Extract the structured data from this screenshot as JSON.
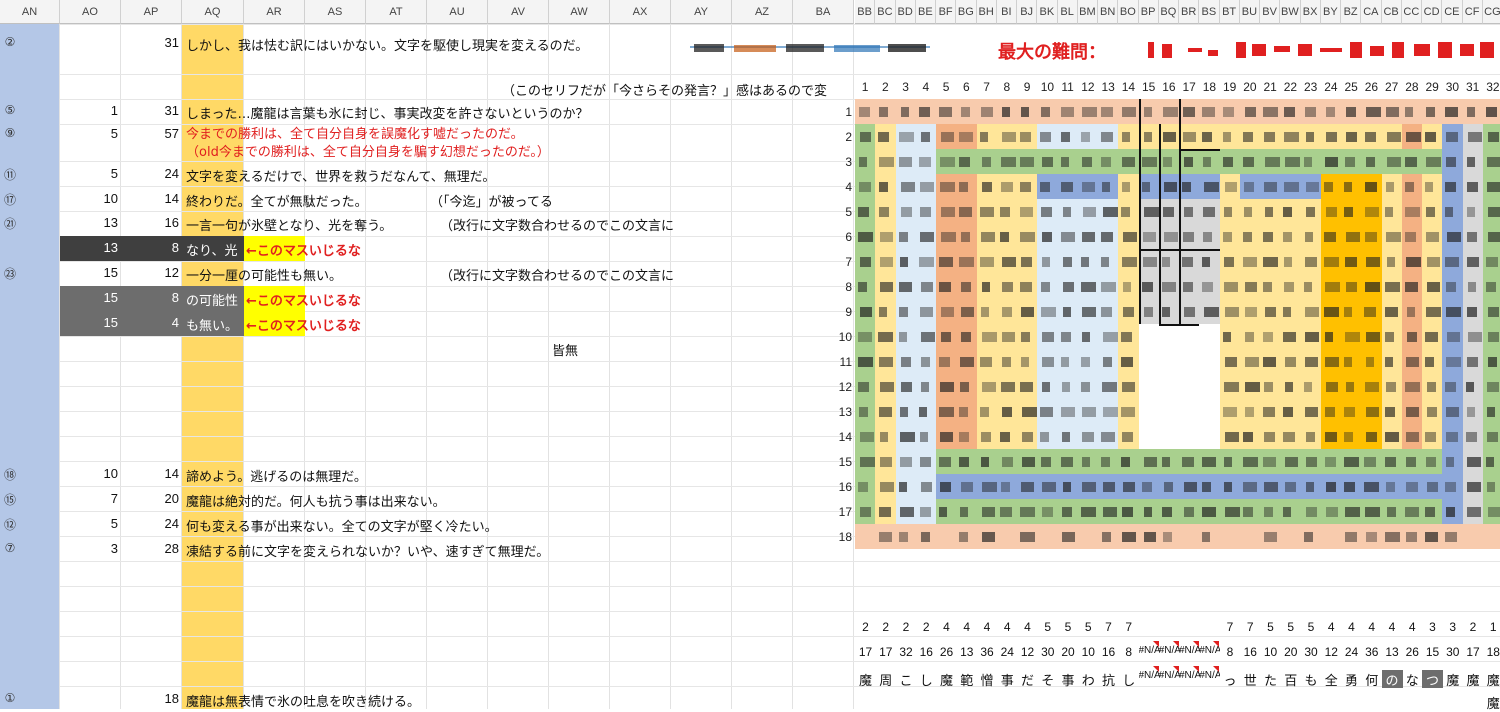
{
  "columns_left": [
    "AN",
    "AO",
    "AP",
    "AQ",
    "AR",
    "AS",
    "AT",
    "AU",
    "AV",
    "AW",
    "AX",
    "AY",
    "AZ",
    "BA"
  ],
  "columns_right": [
    "BB",
    "BC",
    "BD",
    "BE",
    "BF",
    "BG",
    "BH",
    "BI",
    "BJ",
    "BK",
    "BL",
    "BM",
    "BN",
    "BO",
    "BP",
    "BQ",
    "BR",
    "BS",
    "BT",
    "BU",
    "BV",
    "BW",
    "BX",
    "BY",
    "BZ",
    "CA",
    "CB",
    "CC",
    "CD",
    "CE",
    "CF",
    "CG"
  ],
  "rows": [
    {
      "mark": "②",
      "ao": "",
      "ap": "31",
      "text": "しかし、我は怯む訳にはいかない。文字を駆使し現実を変えるのだ。",
      "style": "normal"
    },
    {
      "mark": "",
      "ao": "",
      "ap": "",
      "text": "（このセリフだが「今さらその発言？」感はあるので変",
      "style": "normal"
    },
    {
      "mark": "⑤",
      "ao": "1",
      "ap": "31",
      "text": "しまった…魔龍は言葉も氷に封じ、事実改変を許さないというのか？",
      "style": "normal"
    },
    {
      "mark": "⑨",
      "ao": "5",
      "ap": "57",
      "text": "今までの勝利は、全て自分自身を誤魔化す嘘だったのだ。",
      "text2": "（old今までの勝利は、全て自分自身を騙す幻想だったのだ。）",
      "style": "red"
    },
    {
      "mark": "⑪",
      "ao": "5",
      "ap": "24",
      "text": "文字を変えるだけで、世界を救うだなんて、無理だ。",
      "style": "normal"
    },
    {
      "mark": "⑰",
      "ao": "10",
      "ap": "14",
      "text": "終わりだ。全てが無駄だった。",
      "note": "（「今迄」が被ってる",
      "style": "normal"
    },
    {
      "mark": "㉑",
      "ao": "13",
      "ap": "16",
      "text": "一言一句が氷壁となり、光を奪う。",
      "note": "（改行に文字数合わせるのでこの文言に",
      "style": "normal"
    },
    {
      "mark": "",
      "ao": "13",
      "ap": "8",
      "text": "なり、光",
      "warn": "←このマスいじるな",
      "style": "dark"
    },
    {
      "mark": "㉓",
      "ao": "15",
      "ap": "12",
      "text": "一分一厘の可能性も無い。",
      "note": "（改行に文字数合わせるのでこの文言に",
      "style": "normal"
    },
    {
      "mark": "",
      "ao": "15",
      "ap": "8",
      "text": "の可能性",
      "warn": "←このマスいじるな",
      "style": "gray"
    },
    {
      "mark": "",
      "ao": "15",
      "ap": "4",
      "text": "も無い。",
      "warn": "←このマスいじるな",
      "style": "gray"
    },
    {
      "mark": "",
      "ao": "",
      "ap": "",
      "text": "皆無",
      "style": "center"
    },
    {
      "mark": "⑱",
      "ao": "10",
      "ap": "14",
      "text": "諦めよう。逃げるのは無理だ。",
      "style": "normal"
    },
    {
      "mark": "⑮",
      "ao": "7",
      "ap": "20",
      "text": "魔龍は絶対的だ。何人も抗う事は出来ない。",
      "style": "normal"
    },
    {
      "mark": "⑫",
      "ao": "5",
      "ap": "24",
      "text": "何も変える事が出来ない。全ての文字が堅く冷たい。",
      "style": "normal"
    },
    {
      "mark": "⑦",
      "ao": "3",
      "ap": "28",
      "text": "凍結する前に文字を変えられないか？いや、速すぎて無理だ。",
      "style": "normal"
    },
    {
      "mark": "①",
      "ao": "",
      "ap": "18",
      "text": "魔龍は無表情で氷の吐息を吹き続ける。",
      "style": "normal"
    }
  ],
  "banner": {
    "label": "最大の難問："
  },
  "grid_col_numbers": [
    "1",
    "2",
    "3",
    "4",
    "5",
    "6",
    "7",
    "8",
    "9",
    "10",
    "11",
    "12",
    "13",
    "14",
    "15",
    "16",
    "17",
    "18",
    "19",
    "20",
    "21",
    "22",
    "23",
    "24",
    "25",
    "26",
    "27",
    "28",
    "29",
    "30",
    "31",
    "32"
  ],
  "grid_row_numbers": [
    "1",
    "2",
    "3",
    "4",
    "5",
    "6",
    "7",
    "8",
    "9",
    "10",
    "11",
    "12",
    "13",
    "14",
    "15",
    "16",
    "17",
    "18"
  ],
  "bottom_row1": [
    "2",
    "2",
    "2",
    "2",
    "4",
    "4",
    "4",
    "4",
    "4",
    "5",
    "5",
    "5",
    "7",
    "7",
    "",
    "",
    "",
    "",
    "7",
    "7",
    "5",
    "5",
    "5",
    "4",
    "4",
    "4",
    "4",
    "4",
    "3",
    "3",
    "2",
    "1"
  ],
  "bottom_row2": [
    "17",
    "17",
    "32",
    "16",
    "26",
    "13",
    "36",
    "24",
    "12",
    "30",
    "20",
    "10",
    "16",
    "8",
    "#N/A",
    "#N/A",
    "#N/A",
    "#N/A",
    "8",
    "16",
    "10",
    "20",
    "30",
    "12",
    "24",
    "36",
    "13",
    "26",
    "15",
    "30",
    "17",
    "18"
  ],
  "bottom_row3": [
    "魔",
    "周",
    "こ",
    "し",
    "魔",
    "範",
    "憎",
    "事",
    "だ",
    "そ",
    "事",
    "わ",
    "抗",
    "し",
    "#N/A",
    "#N/A",
    "#N/A",
    "#N/A",
    "っ",
    "世",
    "た",
    "百",
    "も",
    "全",
    "勇",
    "何",
    "の",
    "な",
    "つ",
    "魔",
    "魔",
    "魔"
  ],
  "colors": {
    "blue_col": "#b4c7e7",
    "yellow_col": "#ffd966",
    "green": "#a9d08e",
    "orange": "#f4b183",
    "lightyellow": "#ffe699",
    "lightblue": "#ddebf7",
    "blue": "#8ea9db",
    "gold": "#ffc000",
    "gray": "#d9d9d9",
    "peach": "#f8cbad",
    "red": "#e02020"
  }
}
